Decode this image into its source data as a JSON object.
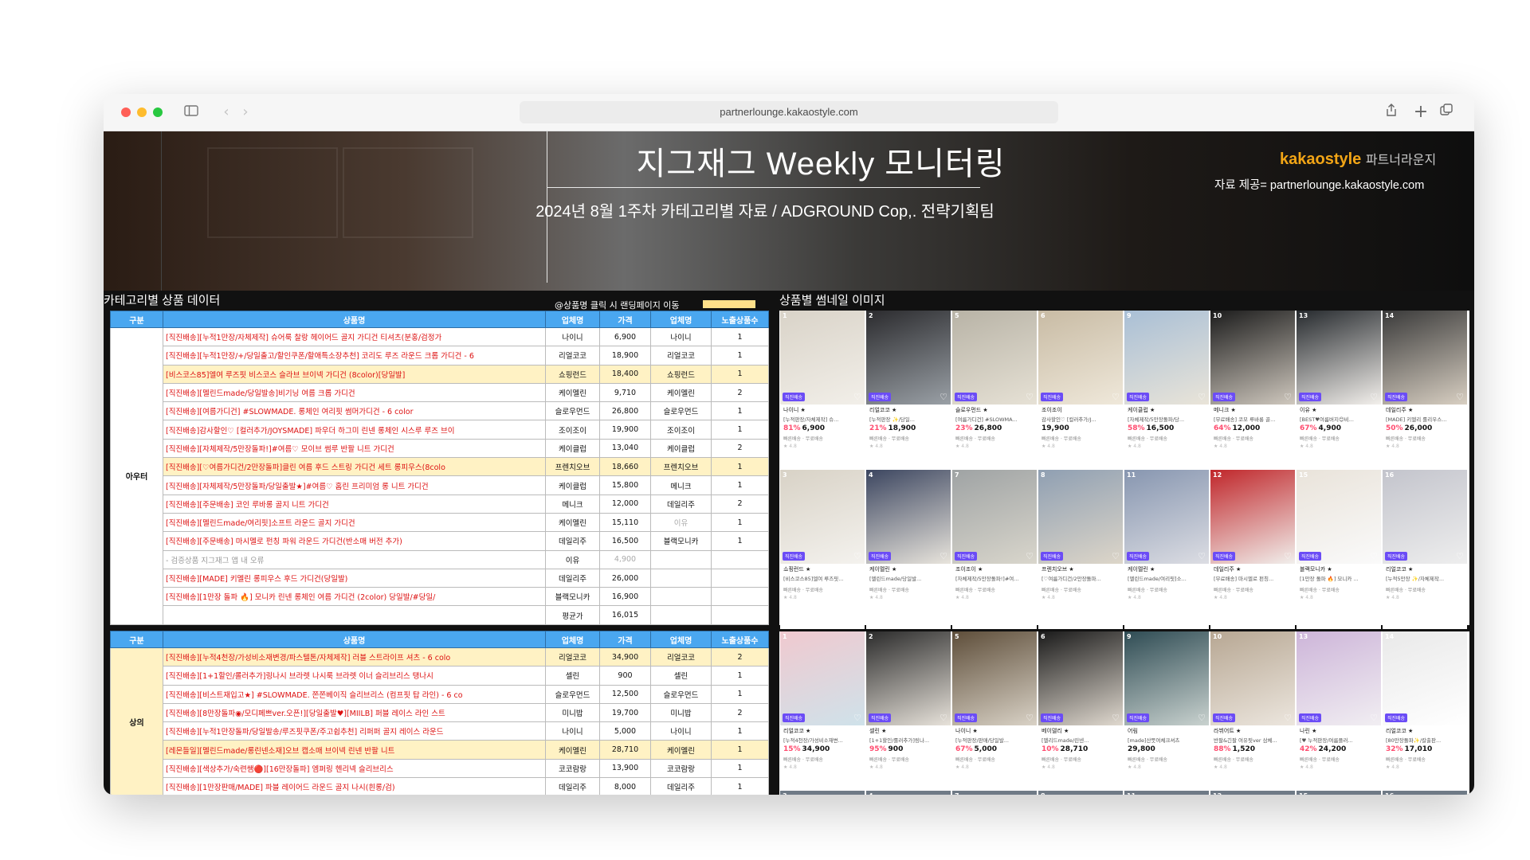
{
  "browser": {
    "url": "partnerlounge.kakaostyle.com"
  },
  "banner": {
    "title": "지그재그 Weekly 모니터링",
    "subtitle": "2024년 8월 1주차 카테고리별 자료 / ADGROUND Cop,. 전략기획팀",
    "brand_name": "kakaostyle",
    "brand_suffix": "파트너라운지",
    "source": "자료 제공= partnerlounge.kakaostyle.com"
  },
  "sections": {
    "table_label": "카테고리별 상품 데이터",
    "click_note": "@상품명 클릭 시 랜딩페이지 이동",
    "images_label": "상품별 썸네일 이미지"
  },
  "table": {
    "headers": [
      "구분",
      "상품명",
      "업체명",
      "가격",
      "업체명",
      "노출상품수"
    ],
    "outer": {
      "category": "아우터",
      "rows": [
        {
          "name": "[직진배송][누적1만장/자체제작] 슈어룩 찰랑 헤이어드 골지 가디건 티셔츠(분홍/검정가",
          "store": "나이니",
          "price": "6,900",
          "store2": "나이니",
          "count": "1",
          "hl": false
        },
        {
          "name": "[직진배송][누적1만장/+/당일출고/할인쿠폰/할애특소장추천] 코리도 루즈 라운드 크롭 가디건 - 6",
          "store": "리얼코코",
          "price": "18,900",
          "store2": "리얼코코",
          "count": "1",
          "hl": false
        },
        {
          "name": "[비스코스85]엘여 루즈핏 비스코스 슬라브 브이넥 가디건 (8color)[당일발]",
          "store": "쇼핑런드",
          "price": "18,400",
          "store2": "쇼핑런드",
          "count": "1",
          "hl": true
        },
        {
          "name": "[직진배송][멜린드made/당일발송]비기닝 여름 크롭 가디건",
          "store": "케이멜린",
          "price": "9,710",
          "store2": "케이멜린",
          "count": "2",
          "hl": false
        },
        {
          "name": "[직진배송][여름가디건] #SLOWMADE. 롱체인 여리핏 썸머가디건 - 6 color",
          "store": "슬로우먼드",
          "price": "26,800",
          "store2": "슬로우먼드",
          "count": "1",
          "hl": false
        },
        {
          "name": "[직진배송]감사할인♡ [컬러추가/JOYSMADE] 파우더 하그미 린넨 롱체인 시스루 루즈 브이",
          "store": "조이조이",
          "price": "19,900",
          "store2": "조이조이",
          "count": "1",
          "hl": false
        },
        {
          "name": "[직진배송][자체제작/5만장돌파!]#여름♡ 모이브 썸루 반팔 니트 가디건",
          "store": "케이클럽",
          "price": "13,040",
          "store2": "케이클럽",
          "count": "2",
          "hl": false
        },
        {
          "name": "[직진배송][♡여름가디건/2만장돌파]클린 여름 후드 스트링 가디건 세트 롱피우스(8colo",
          "store": "프렌치오브",
          "price": "18,660",
          "store2": "프렌치오브",
          "count": "1",
          "hl": true
        },
        {
          "name": "[직진배송][자체제작/5만장돌파/당일출발★]#여름♡ 홈린 프리미엄 롱 니트 가디건",
          "store": "케이클럽",
          "price": "15,800",
          "store2": "메니크",
          "count": "1",
          "hl": false
        },
        {
          "name": "[직진배송][주문배송] 코인 루바롱 골지 니트 가디건",
          "store": "메니크",
          "price": "12,000",
          "store2": "데일리주",
          "count": "2",
          "hl": false
        },
        {
          "name": "[직진배송][멜린드made/여리핏]소프트 라운드 골지 가디건",
          "store": "케이멜린",
          "price": "15,110",
          "store2": "이유",
          "count": "1",
          "hl": false
        },
        {
          "name": "[직진배송][주문배송] 마시멜로 펀칭 파워 라운드 가디건(반소매 버전 추가)",
          "store": "데일리주",
          "price": "16,500",
          "store2": "블랙모니카",
          "count": "1",
          "hl": false
        },
        {
          "name": "- 검증상품 지그재그 앱 내 오류",
          "store": "이유",
          "price": "4,900",
          "store2": "",
          "count": "",
          "hl": false,
          "gray": true
        },
        {
          "name": "[직진배송][MADE] 키멜린 롱피우스 후드 가디건(당일발)",
          "store": "데일리주",
          "price": "26,000",
          "store2": "",
          "count": "",
          "hl": false
        },
        {
          "name": "[직진배송][1만장 돌파 🔥] 모니카 린넨 롱체인 여름 가디건 (2color) 당일발/#당일/",
          "store": "블랙모니카",
          "price": "16,900",
          "store2": "",
          "count": "",
          "hl": false
        },
        {
          "name": "",
          "store": "평균가",
          "price": "16,015",
          "store2": "",
          "count": "",
          "hl": false
        }
      ]
    },
    "top": {
      "category": "상의",
      "rows": [
        {
          "name": "[직진배송][누적4천장/가성비소재변경/파스텔톤/자체제작] 러블 스트라이프 셔츠 - 6 colo",
          "store": "리얼코코",
          "price": "34,900",
          "store2": "리얼코코",
          "count": "2",
          "hl": true
        },
        {
          "name": "[직진배송][1+1할인/롤러추가]링나시 브라렛 나시룩 브라렛 이너 슬리브리스 탱나시",
          "store": "셀린",
          "price": "900",
          "store2": "셀린",
          "count": "1",
          "hl": false
        },
        {
          "name": "[직진배송][비스트재입고★] #SLOWMADE. 쫀쫀베이직 슬리브리스 (컴프핏 탑 라인) - 6 co",
          "store": "슬로우먼드",
          "price": "12,500",
          "store2": "슬로우먼드",
          "count": "1",
          "hl": false
        },
        {
          "name": "[직진배송][8만장돌파◉/모디페쁘ver.오픈!][당일출발♥][MIILB] 퍼블 레이스 라인 스트",
          "store": "미니밥",
          "price": "19,700",
          "store2": "미니밥",
          "count": "2",
          "hl": false
        },
        {
          "name": "[직진배송][누적1만장돌파/당일발송/루즈핏쿠폰/주고쉽추천] 리퍼퍼 골지 레이스 라운드",
          "store": "나이니",
          "price": "5,000",
          "store2": "나이니",
          "count": "1",
          "hl": false
        },
        {
          "name": "[레몬들일][멜린드made/롱린넨소재]오브 캡소매 브이넥 린넨 반팔 니트",
          "store": "케이멜린",
          "price": "28,710",
          "store2": "케이멜린",
          "count": "1",
          "hl": true
        },
        {
          "name": "[직진배송][색상추가/숙련쌤🔴][16만장돌파] 엠퍼링 헨리넥 슬리브리스",
          "store": "코코람랑",
          "price": "13,900",
          "store2": "코코람랑",
          "count": "1",
          "hl": false
        },
        {
          "name": "[직진배송][1만장판매/MADE] 파블 레이어드 라운드 골지 나시(흰롱/검)",
          "store": "데일리주",
          "price": "8,000",
          "store2": "데일리주",
          "count": "1",
          "hl": false
        }
      ]
    }
  },
  "thumbs_top": [
    {
      "num": "1",
      "store": "나이니 ★",
      "pname": "[누적판장/자체제작] 슈...",
      "disc": "81%",
      "price": "6,900",
      "colors": [
        "#d9d3c8",
        "#f2efe9"
      ]
    },
    {
      "num": "2",
      "store": "리얼코코 ★",
      "pname": "[누적판장 ✨/당일...",
      "disc": "21%",
      "price": "18,900",
      "colors": [
        "#2b2b2e",
        "#9aa0a6"
      ]
    },
    {
      "num": "5",
      "store": "슬로우먼드 ★",
      "pname": "[여름가디건] #SLOWMA...",
      "disc": "23%",
      "price": "26,800",
      "colors": [
        "#b8b3a6",
        "#e6e1d5"
      ]
    },
    {
      "num": "6",
      "store": "조이조이",
      "pname": "감사할인♡ [컬러추가/J...",
      "disc": "",
      "price": "19,900",
      "colors": [
        "#c8bba4",
        "#efe8da"
      ]
    },
    {
      "num": "9",
      "store": "케이클럽 ★",
      "pname": "[자체제작/5만장돌파/당...",
      "disc": "58%",
      "price": "16,500",
      "colors": [
        "#a9bfd6",
        "#e9e4d8"
      ]
    },
    {
      "num": "10",
      "store": "메니크 ★",
      "pname": "[무료배송] 코모 루바롱 골...",
      "disc": "64%",
      "price": "12,000",
      "colors": [
        "#1c1c1c",
        "#cfc8be"
      ]
    },
    {
      "num": "13",
      "store": "이유 ★",
      "pname": "[BEST♥여름버지😊비...",
      "disc": "67%",
      "price": "4,900",
      "colors": [
        "#262a2e",
        "#f3f0ec"
      ]
    },
    {
      "num": "14",
      "store": "데일리주 ★",
      "pname": "[MADE] 키멜리 롤리우스...",
      "disc": "50%",
      "price": "26,000",
      "colors": [
        "#3a3a3a",
        "#d8cfc2"
      ]
    }
  ],
  "thumbs_mid": [
    {
      "num": "3",
      "store": "쇼핑런드 ★",
      "pname": "[비스코스85]엘여 루즈핏...",
      "disc": "",
      "price": "",
      "colors": [
        "#d8d2c6",
        "#f4f2ee"
      ]
    },
    {
      "num": "4",
      "store": "케이멜린 ★",
      "pname": "[멜린드made/당일발...",
      "disc": "",
      "price": "",
      "colors": [
        "#3c4660",
        "#e8e4dc"
      ]
    },
    {
      "num": "7",
      "store": "조이조이 ★",
      "pname": "[자체제작/5만장돌파!]#여...",
      "disc": "",
      "price": "",
      "colors": [
        "#9fa3a4",
        "#d9d6cc"
      ]
    },
    {
      "num": "8",
      "store": "프렌치오브 ★",
      "pname": "[♡여름가디건/2만장돌파...",
      "disc": "",
      "price": "",
      "colors": [
        "#8f9fb2",
        "#ddd6c9"
      ]
    },
    {
      "num": "11",
      "store": "케이멜린 ★",
      "pname": "[멜린드made/여리핏]소...",
      "disc": "",
      "price": "",
      "colors": [
        "#8796b0",
        "#dcdde3"
      ]
    },
    {
      "num": "12",
      "store": "데일리주 ★",
      "pname": "[무료배송] 마시멜로 펀칭...",
      "disc": "",
      "price": "",
      "colors": [
        "#c0262a",
        "#f1efec"
      ]
    },
    {
      "num": "15",
      "store": "블랙모니카 ★",
      "pname": "[1만장 돌파 🔥] 모니카 ...",
      "disc": "",
      "price": "",
      "colors": [
        "#e9e3da",
        "#fafafa"
      ]
    },
    {
      "num": "16",
      "store": "리얼코코 ★",
      "pname": "[누적5만장 ✨/자체제작...",
      "disc": "",
      "price": "",
      "colors": [
        "#c3c4cc",
        "#eeeeee"
      ]
    }
  ],
  "thumbs_bottom": [
    {
      "num": "1",
      "store": "리얼코코 ★",
      "pname": "[누적4천장/가성비소재변...",
      "disc": "15%",
      "price": "34,900",
      "colors": [
        "#f0c9cf",
        "#cfe2ea"
      ]
    },
    {
      "num": "2",
      "store": "셀린 ★",
      "pname": "[1+1할인/롤러추가]링나...",
      "disc": "95%",
      "price": "900",
      "colors": [
        "#2b2b2b",
        "#e7e2da"
      ]
    },
    {
      "num": "5",
      "store": "나이니 ★",
      "pname": "[누적판장/판매/당일발...",
      "disc": "67%",
      "price": "5,000",
      "colors": [
        "#5e4e3a",
        "#d9d2c6"
      ]
    },
    {
      "num": "6",
      "store": "베이델리 ★",
      "pname": "[멜리드made/린넨...",
      "disc": "10%",
      "price": "28,710",
      "colors": [
        "#1a1a1a",
        "#e0d9cf"
      ]
    },
    {
      "num": "9",
      "store": "어림",
      "pname": "[made]산뜻여체크셔츠",
      "disc": "",
      "price": "29,800",
      "colors": [
        "#2f4c54",
        "#c9d2cf"
      ]
    },
    {
      "num": "10",
      "store": "라뷔어트 ★",
      "pname": "반팔&긴팔 여유핏ver 삼체...",
      "disc": "88%",
      "price": "1,520",
      "colors": [
        "#b7a793",
        "#ece6de"
      ]
    },
    {
      "num": "13",
      "store": "나린 ★",
      "pname": "[♥ 누적판장/여름플러...",
      "disc": "42%",
      "price": "24,200",
      "colors": [
        "#cdb5d9",
        "#f1eef2"
      ]
    },
    {
      "num": "14",
      "store": "리얼코코 ★",
      "pname": "[80만장돌파✨/칼출판...",
      "disc": "32%",
      "price": "17,010",
      "colors": [
        "#e9e9e9",
        "#ffffff"
      ]
    }
  ],
  "thumbs_peek": [
    "3",
    "4",
    "7",
    "8",
    "11",
    "12",
    "15",
    "16"
  ],
  "colors": {
    "header_blue": "#4aa7f0",
    "highlight": "#fff2c4",
    "price_red": "#ff4b6e",
    "tag_purple": "#6b4cf6",
    "brand_orange": "#f2a516"
  }
}
